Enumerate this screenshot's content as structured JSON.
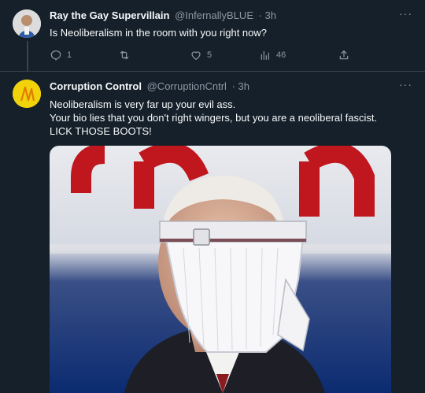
{
  "tweets": [
    {
      "display_name": "Ray the Gay Supervillain",
      "handle": "@InfernallyBLUE",
      "time": "· 3h",
      "text": "Is Neoliberalism in the room with you right now?",
      "replies": "1",
      "retweets": "",
      "likes": "5",
      "views": "46",
      "avatar_icon": "profile-photo-icon",
      "more_label": "···"
    },
    {
      "display_name": "Corruption Control",
      "handle": "@CorruptionCntrl",
      "time": "· 3h",
      "lines": [
        "Neoliberalism is very far up your evil ass.",
        "Your bio lies that you don't right wingers, but you are a neoliberal fascist.",
        "LICK THOSE BOOTS!"
      ],
      "more_label": "···",
      "avatar_icon": "yellow-avatar-icon",
      "media_logo": "CNN"
    }
  ],
  "colors": {
    "background": "#15202b",
    "text": "#f7f9f9",
    "muted": "#8b98a5",
    "divider": "#38444d"
  }
}
